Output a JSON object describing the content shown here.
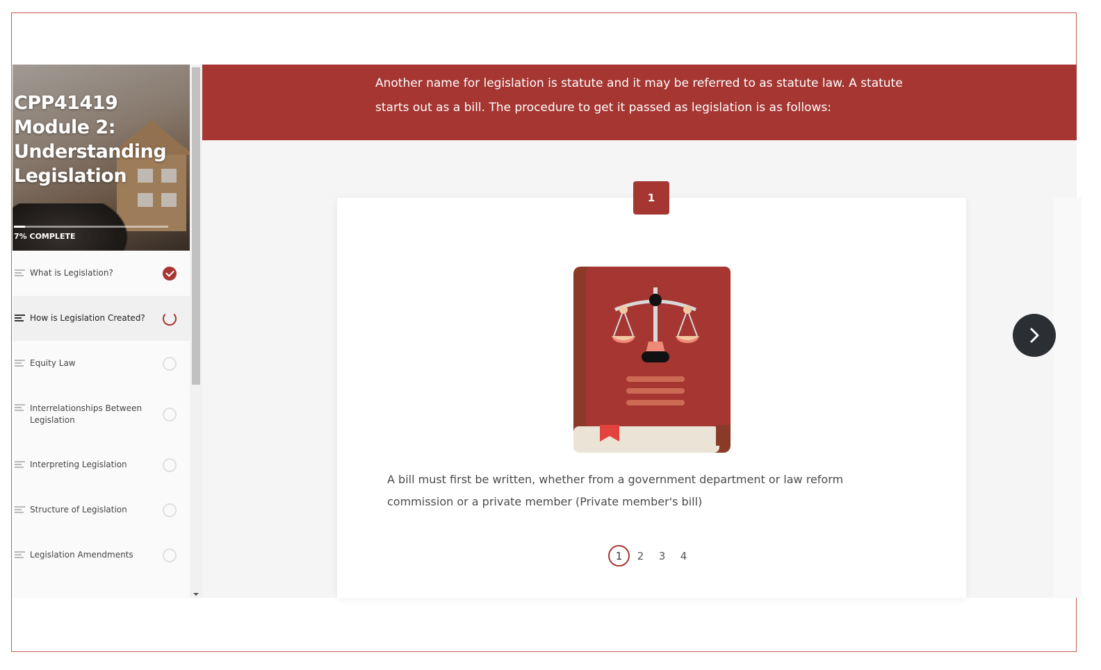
{
  "course": {
    "title": "CPP41419 Module 2: Understanding Legislation",
    "progress_label": "7% COMPLETE",
    "progress_fraction": 0.07
  },
  "lessons": [
    {
      "label": "What is Legislation?",
      "status": "done"
    },
    {
      "label": "How is Legislation Created?",
      "status": "in-progress"
    },
    {
      "label": "Equity Law",
      "status": "not-started"
    },
    {
      "label": "Interrelationships Between Legislation",
      "status": "not-started"
    },
    {
      "label": "Interpreting Legislation",
      "status": "not-started"
    },
    {
      "label": "Structure of Legislation",
      "status": "not-started"
    },
    {
      "label": "Legislation Amendments",
      "status": "not-started"
    }
  ],
  "banner": {
    "text": "Another name for legislation is statute and it may be referred to as statute law. A statute starts out as a bill. The procedure to get it passed as legislation is as follows:"
  },
  "step": {
    "number": "1",
    "icon": "law-book-scales-icon",
    "text": "A bill must first be written, whether from a government department or law reform commission or a private member (Private member's bill)"
  },
  "pager": {
    "pages": [
      "1",
      "2",
      "3",
      "4"
    ],
    "current": "1"
  },
  "colors": {
    "accent": "#a53632",
    "next_button": "#2b2f33"
  }
}
